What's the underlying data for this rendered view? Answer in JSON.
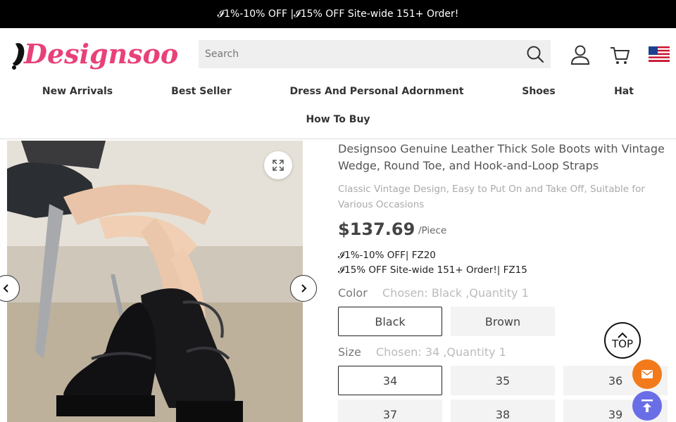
{
  "promo": {
    "text": "𝓘1%-10% OFF |𝓘15% OFF Site-wide 151+ Order!"
  },
  "header": {
    "logo_text": "Designsoo",
    "search_placeholder": "Search"
  },
  "nav": {
    "items": [
      "New Arrivals",
      "Best Seller",
      "Dress And Personal Adornment",
      "Shoes",
      "Hat",
      "How To Buy"
    ]
  },
  "product": {
    "title": "Designsoo Genuine Leather Thick Sole Boots with Vintage Wedge, Round Toe, and Hook-and-Loop Straps",
    "subtitle": "Classic Vintage Design, Easy to Put On and Take Off, Suitable for Various Occasions",
    "price": "$137.69",
    "unit": "/Piece",
    "coupons": [
      "𝓘1%-10% OFF| FZ20",
      "𝓘15% OFF Site-wide 151+ Order!| FZ15"
    ],
    "color": {
      "label": "Color",
      "chosen": "Chosen: Black ,Quantity 1",
      "options": [
        "Black",
        "Brown"
      ],
      "selected": "Black"
    },
    "size": {
      "label": "Size",
      "chosen": "Chosen: 34 ,Quantity 1",
      "options": [
        "34",
        "35",
        "36",
        "37",
        "38",
        "39"
      ],
      "selected": "34"
    }
  },
  "floating": {
    "top_label": "TOP"
  },
  "colors": {
    "promo_bg": "#000000",
    "logo_pink": "#e8417a",
    "mail_btn": "#f27a1a",
    "scroll_btn": "#6a6ee6"
  }
}
